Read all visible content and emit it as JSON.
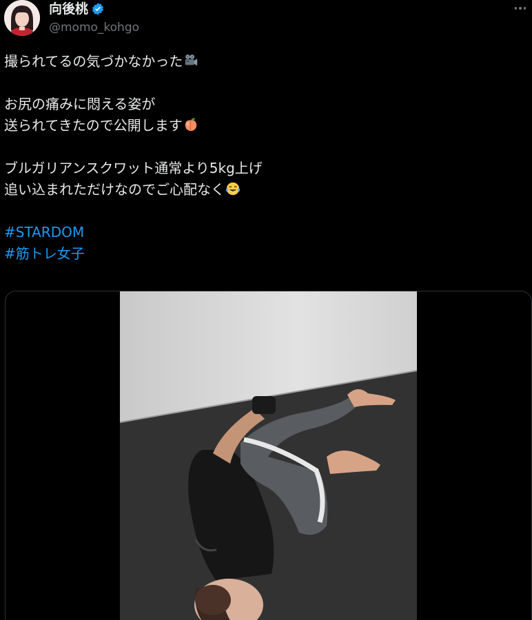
{
  "author": {
    "display_name": "向後桃",
    "handle": "@momo_kohgo",
    "verified": true
  },
  "tweet": {
    "lines": [
      {
        "text": "撮られてるの気づかなかった",
        "emoji": "movie-camera-icon"
      },
      {
        "text": "お尻の痛みに悶える姿が",
        "emoji": null
      },
      {
        "text": "送られてきたので公開します",
        "emoji": "peach-icon"
      },
      {
        "text": "ブルガリアンスクワット通常より5kg上げ",
        "emoji": null
      },
      {
        "text": "追い込まれただけなのでご心配なく",
        "emoji": "tears-of-joy-icon"
      }
    ],
    "hashtags": [
      "#STARDOM",
      "#筋トレ女子"
    ]
  },
  "media": {
    "type": "video",
    "description_icon": "video-thumbnail"
  },
  "colors": {
    "background": "#000000",
    "text": "#e7e9ea",
    "secondary": "#71767b",
    "link": "#1d9bf0",
    "verified": "#1d9bf0",
    "border": "#2f3336"
  }
}
